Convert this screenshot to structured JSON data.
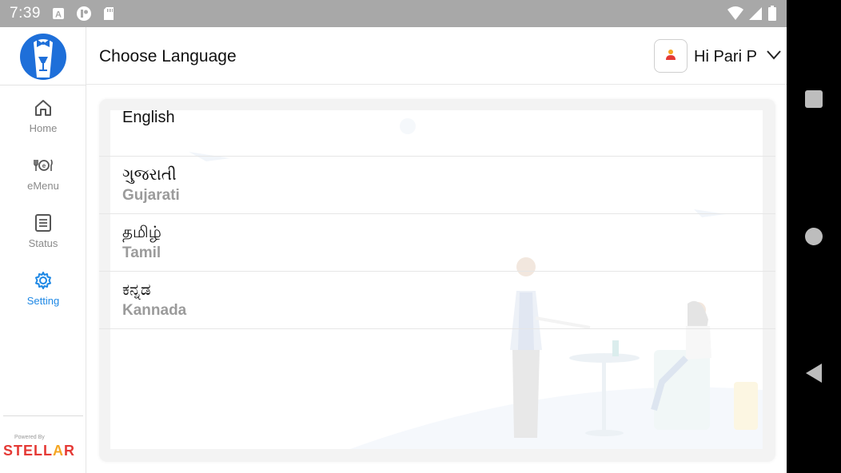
{
  "status_bar": {
    "time": "7:39",
    "icons": [
      "a-badge-icon",
      "circle-badge-icon",
      "sd-card-icon",
      "wifi-icon",
      "signal-icon",
      "battery-icon"
    ],
    "background": "#a8a8a8"
  },
  "sidebar": {
    "items": [
      {
        "label": "Home",
        "icon": "home-icon",
        "active": false
      },
      {
        "label": "eMenu",
        "icon": "emenu-icon",
        "active": false
      },
      {
        "label": "Status",
        "icon": "status-icon",
        "active": false
      },
      {
        "label": "Setting",
        "icon": "gear-icon",
        "active": true
      }
    ],
    "powered_by": "Powered By",
    "brand": "STELLAR"
  },
  "header": {
    "title": "Choose Language",
    "greeting": "Hi Pari P"
  },
  "languages": [
    {
      "native": "English",
      "english": ""
    },
    {
      "native": "ગુજરાતી",
      "english": "Gujarati"
    },
    {
      "native": "தமிழ்",
      "english": "Tamil"
    },
    {
      "native": "ಕನ್ನಡ",
      "english": "Kannada"
    }
  ],
  "colors": {
    "accent": "#1e88e5",
    "brand_red": "#e53935",
    "brand_orange": "#f5a623"
  }
}
